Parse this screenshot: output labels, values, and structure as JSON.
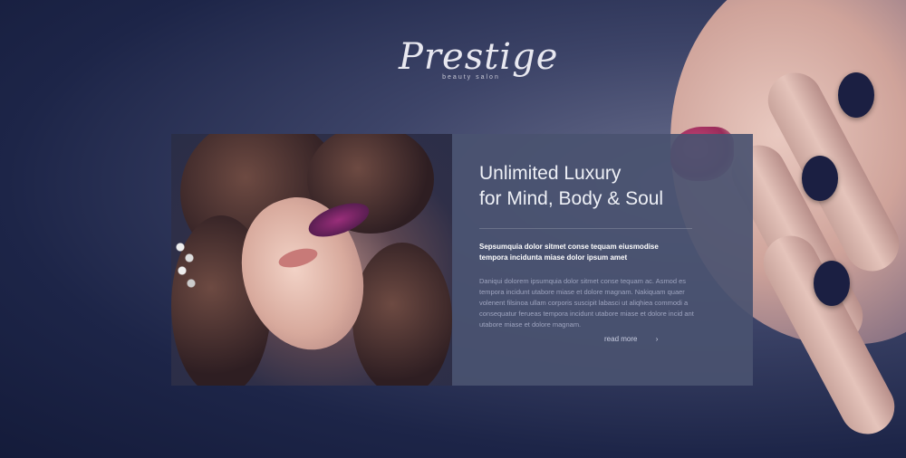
{
  "logo": {
    "script": "Prestige",
    "tagline": "beauty salon"
  },
  "card": {
    "heading_line1": "Unlimited Luxury",
    "heading_line2": "for Mind, Body & Soul",
    "lead": "Sepsumquia dolor sitmet conse tequam eiusmodise tempora incidunta miase dolor ipsum amet",
    "body": "Daniqui dolorem ipsumquia dolor sitmet conse tequam ac. Asmod es tempora incidunt utabore miase et dolore magnam. Nakiquam quaer volenent filsinoa ullam corporis suscipit labasci ut aliqhiea commodi a consequatur ferueas tempora incidunt utabore miase et dolore incid ant utabore miase et dolore magnam.",
    "read_more": "read more",
    "read_more_arrow": "›"
  }
}
